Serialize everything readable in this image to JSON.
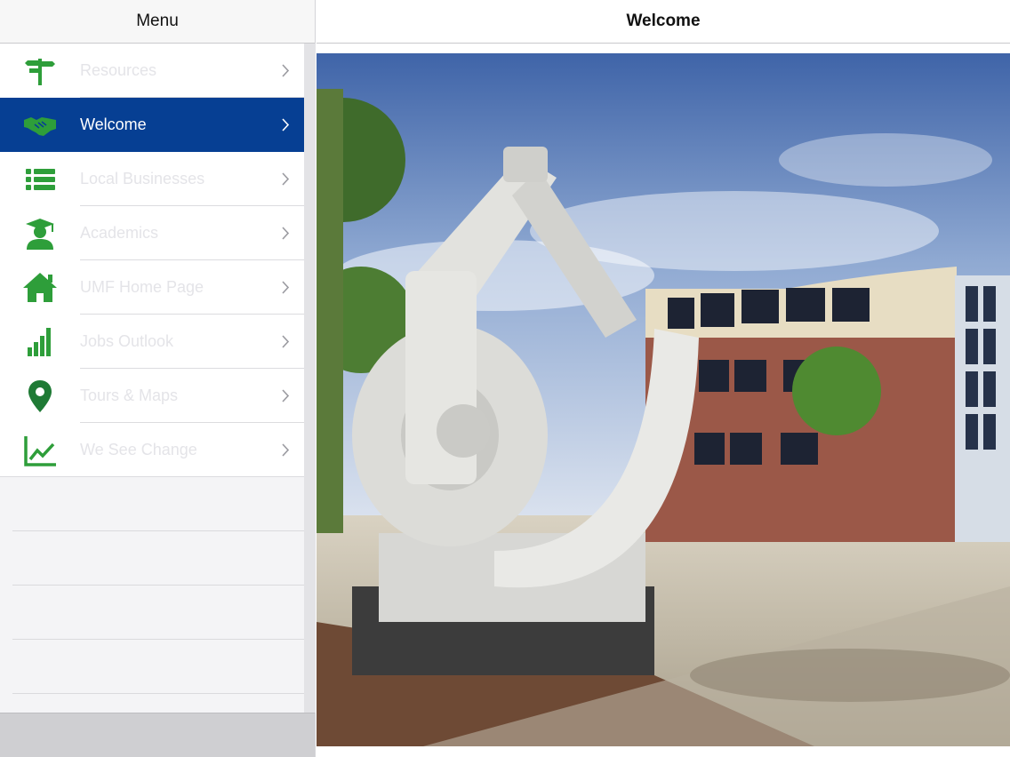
{
  "sidebar": {
    "title": "Menu",
    "items": [
      {
        "label": "Resources",
        "icon": "signpost-icon",
        "active": false
      },
      {
        "label": "Welcome",
        "icon": "handshake-icon",
        "active": true
      },
      {
        "label": "Local Businesses",
        "icon": "list-icon",
        "active": false
      },
      {
        "label": "Academics",
        "icon": "graduate-icon",
        "active": false
      },
      {
        "label": "UMF Home Page",
        "icon": "home-icon",
        "active": false
      },
      {
        "label": "Jobs Outlook",
        "icon": "bar-signal-icon",
        "active": false
      },
      {
        "label": "Tours & Maps",
        "icon": "map-pin-icon",
        "active": false
      },
      {
        "label": "We See Change",
        "icon": "line-chart-icon",
        "active": false
      }
    ]
  },
  "main": {
    "title": "Welcome",
    "image": "campus-sculpture-photo"
  },
  "colors": {
    "accent": "#063f93",
    "icon_green": "#2e9e3a"
  }
}
